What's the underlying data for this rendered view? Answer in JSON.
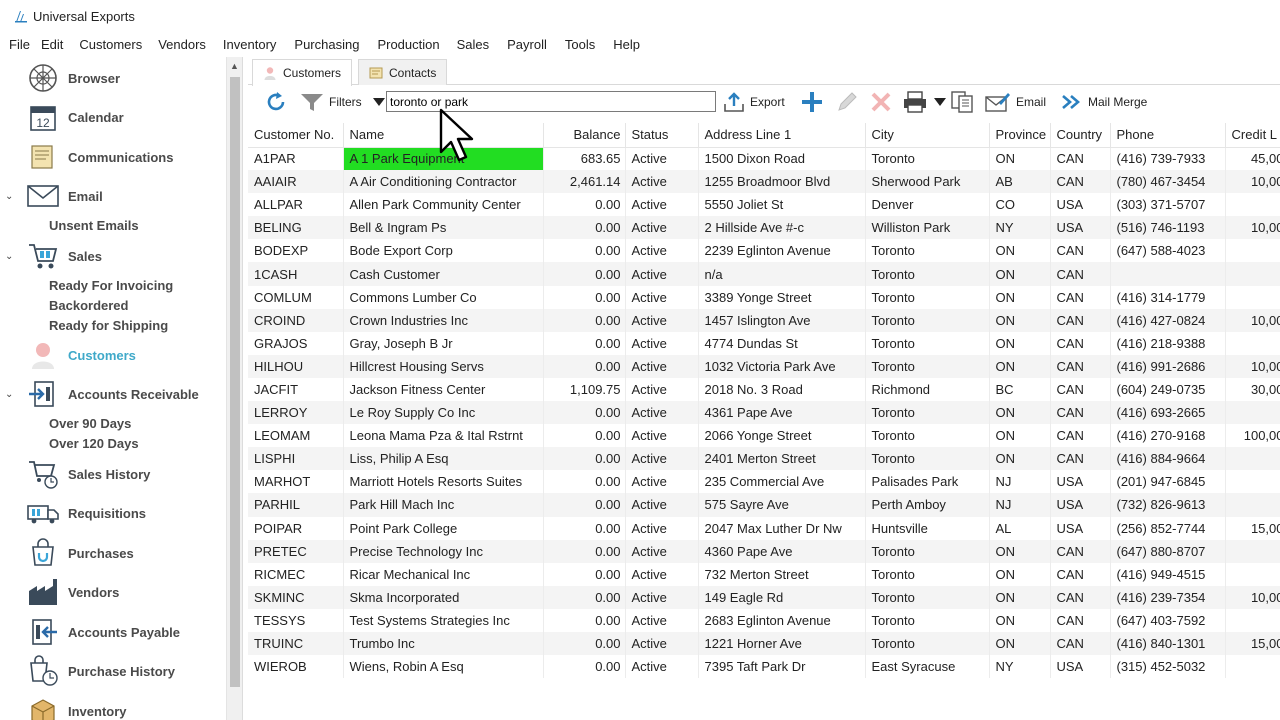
{
  "window": {
    "title": "Universal Exports"
  },
  "menu": [
    "File",
    "Edit",
    "Customers",
    "Vendors",
    "Inventory",
    "Purchasing",
    "Production",
    "Sales",
    "Payroll",
    "Tools",
    "Help"
  ],
  "sidebar": {
    "items": [
      {
        "label": "Browser",
        "icon": "browser-icon"
      },
      {
        "label": "Calendar",
        "icon": "calendar-icon",
        "calendar_day": "12"
      },
      {
        "label": "Communications",
        "icon": "communications-icon"
      },
      {
        "label": "Email",
        "icon": "email-icon"
      },
      {
        "label": "Sales",
        "icon": "sales-cart-icon"
      },
      {
        "label": "Customers",
        "icon": "customers-icon"
      },
      {
        "label": "Accounts Receivable",
        "icon": "accounts-receivable-icon"
      },
      {
        "label": "Sales History",
        "icon": "sales-history-icon"
      },
      {
        "label": "Requisitions",
        "icon": "requisitions-icon"
      },
      {
        "label": "Purchases",
        "icon": "purchases-icon"
      },
      {
        "label": "Vendors",
        "icon": "vendors-factory-icon"
      },
      {
        "label": "Accounts Payable",
        "icon": "accounts-payable-icon"
      },
      {
        "label": "Purchase History",
        "icon": "purchase-history-icon"
      },
      {
        "label": "Inventory",
        "icon": "inventory-icon"
      }
    ],
    "email_sub": [
      "Unsent Emails"
    ],
    "sales_sub": [
      "Ready For Invoicing",
      "Backordered",
      "Ready for Shipping"
    ],
    "ar_sub": [
      "Over 90 Days",
      "Over 120 Days"
    ]
  },
  "tabs": [
    {
      "label": "Customers",
      "icon": "customer-person-icon"
    },
    {
      "label": "Contacts",
      "icon": "contacts-card-icon"
    }
  ],
  "toolbar": {
    "filters_label": "Filters",
    "search_value": "toronto or park",
    "export_label": "Export",
    "email_label": "Email",
    "mail_merge_label": "Mail Merge"
  },
  "table": {
    "columns": [
      "Customer No.",
      "Name",
      "Balance",
      "Status",
      "Address Line 1",
      "City",
      "Province",
      "Country",
      "Phone",
      "Credit L"
    ],
    "rows": [
      [
        "A1PAR",
        "A 1 Park Equipment",
        "683.65",
        "Active",
        "1500 Dixon Road",
        "Toronto",
        "ON",
        "CAN",
        "(416) 739-7933",
        "45,00"
      ],
      [
        "AAIAIR",
        "A Air Conditioning Contractor",
        "2,461.14",
        "Active",
        "1255 Broadmoor Blvd",
        "Sherwood Park",
        "AB",
        "CAN",
        "(780) 467-3454",
        "10,00"
      ],
      [
        "ALLPAR",
        "Allen Park Community Center",
        "0.00",
        "Active",
        "5550 Joliet St",
        "Denver",
        "CO",
        "USA",
        "(303) 371-5707",
        ""
      ],
      [
        "BELING",
        "Bell & Ingram Ps",
        "0.00",
        "Active",
        "2 Hillside Ave #-c",
        "Williston Park",
        "NY",
        "USA",
        "(516) 746-1193",
        "10,00"
      ],
      [
        "BODEXP",
        "Bode Export Corp",
        "0.00",
        "Active",
        "2239 Eglinton Avenue",
        "Toronto",
        "ON",
        "CAN",
        "(647) 588-4023",
        ""
      ],
      [
        "1CASH",
        "Cash Customer",
        "0.00",
        "Active",
        "n/a",
        "Toronto",
        "ON",
        "CAN",
        "",
        ""
      ],
      [
        "COMLUM",
        "Commons Lumber Co",
        "0.00",
        "Active",
        "3389 Yonge Street",
        "Toronto",
        "ON",
        "CAN",
        "(416) 314-1779",
        ""
      ],
      [
        "CROIND",
        "Crown Industries Inc",
        "0.00",
        "Active",
        "1457 Islington Ave",
        "Toronto",
        "ON",
        "CAN",
        "(416) 427-0824",
        "10,00"
      ],
      [
        "GRAJOS",
        "Gray, Joseph B Jr",
        "0.00",
        "Active",
        "4774 Dundas St",
        "Toronto",
        "ON",
        "CAN",
        "(416) 218-9388",
        ""
      ],
      [
        "HILHOU",
        "Hillcrest Housing Servs",
        "0.00",
        "Active",
        "1032 Victoria Park Ave",
        "Toronto",
        "ON",
        "CAN",
        "(416) 991-2686",
        "10,00"
      ],
      [
        "JACFIT",
        "Jackson Fitness Center",
        "1,109.75",
        "Active",
        "2018 No. 3 Road",
        "Richmond",
        "BC",
        "CAN",
        "(604) 249-0735",
        "30,00"
      ],
      [
        "LERROY",
        "Le Roy Supply Co Inc",
        "0.00",
        "Active",
        "4361 Pape Ave",
        "Toronto",
        "ON",
        "CAN",
        "(416) 693-2665",
        ""
      ],
      [
        "LEOMAM",
        "Leona Mama Pza & Ital Rstrnt",
        "0.00",
        "Active",
        "2066 Yonge Street",
        "Toronto",
        "ON",
        "CAN",
        "(416) 270-9168",
        "100,00"
      ],
      [
        "LISPHI",
        "Liss, Philip A Esq",
        "0.00",
        "Active",
        "2401 Merton Street",
        "Toronto",
        "ON",
        "CAN",
        "(416) 884-9664",
        ""
      ],
      [
        "MARHOT",
        "Marriott Hotels Resorts Suites",
        "0.00",
        "Active",
        "235 Commercial Ave",
        "Palisades Park",
        "NJ",
        "USA",
        "(201) 947-6845",
        ""
      ],
      [
        "PARHIL",
        "Park Hill Mach Inc",
        "0.00",
        "Active",
        "575 Sayre Ave",
        "Perth Amboy",
        "NJ",
        "USA",
        "(732) 826-9613",
        ""
      ],
      [
        "POIPAR",
        "Point Park College",
        "0.00",
        "Active",
        "2047 Max Luther Dr Nw",
        "Huntsville",
        "AL",
        "USA",
        "(256) 852-7744",
        "15,00"
      ],
      [
        "PRETEC",
        "Precise Technology Inc",
        "0.00",
        "Active",
        "4360 Pape Ave",
        "Toronto",
        "ON",
        "CAN",
        "(647) 880-8707",
        ""
      ],
      [
        "RICMEC",
        "Ricar Mechanical Inc",
        "0.00",
        "Active",
        "732 Merton Street",
        "Toronto",
        "ON",
        "CAN",
        "(416) 949-4515",
        ""
      ],
      [
        "SKMINC",
        "Skma Incorporated",
        "0.00",
        "Active",
        "149 Eagle Rd",
        "Toronto",
        "ON",
        "CAN",
        "(416) 239-7354",
        "10,00"
      ],
      [
        "TESSYS",
        "Test Systems Strategies Inc",
        "0.00",
        "Active",
        "2683 Eglinton Avenue",
        "Toronto",
        "ON",
        "CAN",
        "(647) 403-7592",
        ""
      ],
      [
        "TRUINC",
        "Trumbo Inc",
        "0.00",
        "Active",
        "1221 Horner Ave",
        "Toronto",
        "ON",
        "CAN",
        "(416) 840-1301",
        "15,00"
      ],
      [
        "WIEROB",
        "Wiens, Robin A Esq",
        "0.00",
        "Active",
        "7395 Taft Park Dr",
        "East Syracuse",
        "NY",
        "USA",
        "(315) 452-5032",
        ""
      ]
    ]
  },
  "colors": {
    "accent": "#3fa9c9",
    "highlight": "#22dd22",
    "row_alt": "#f4f4f4"
  }
}
